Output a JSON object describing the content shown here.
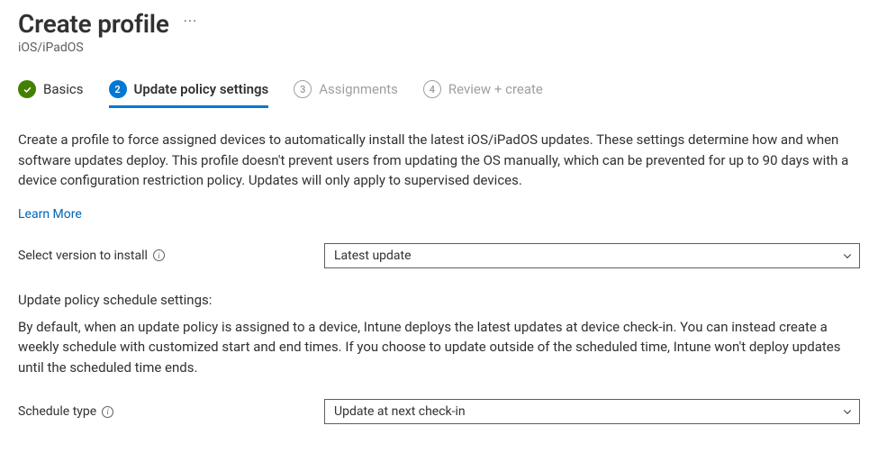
{
  "header": {
    "title": "Create profile",
    "subtitle": "iOS/iPadOS"
  },
  "tabs": {
    "basics": {
      "label": "Basics"
    },
    "update_policy": {
      "number": "2",
      "label": "Update policy settings"
    },
    "assignments": {
      "number": "3",
      "label": "Assignments"
    },
    "review": {
      "number": "4",
      "label": "Review + create"
    }
  },
  "content": {
    "description": "Create a profile to force assigned devices to automatically install the latest iOS/iPadOS updates. These settings determine how and when software updates deploy. This profile doesn't prevent users from updating the OS manually, which can be prevented for up to 90 days with a device configuration restriction policy. Updates will only apply to supervised devices.",
    "learn_more": "Learn More"
  },
  "form": {
    "select_version_label": "Select version to install",
    "select_version_value": "Latest update",
    "schedule_section_title": "Update policy schedule settings:",
    "schedule_section_desc": "By default, when an update policy is assigned to a device, Intune deploys the latest updates at device check-in. You can instead create a weekly schedule with customized start and end times. If you choose to update outside of the scheduled time, Intune won't deploy updates until the scheduled time ends.",
    "schedule_type_label": "Schedule type",
    "schedule_type_value": "Update at next check-in"
  }
}
